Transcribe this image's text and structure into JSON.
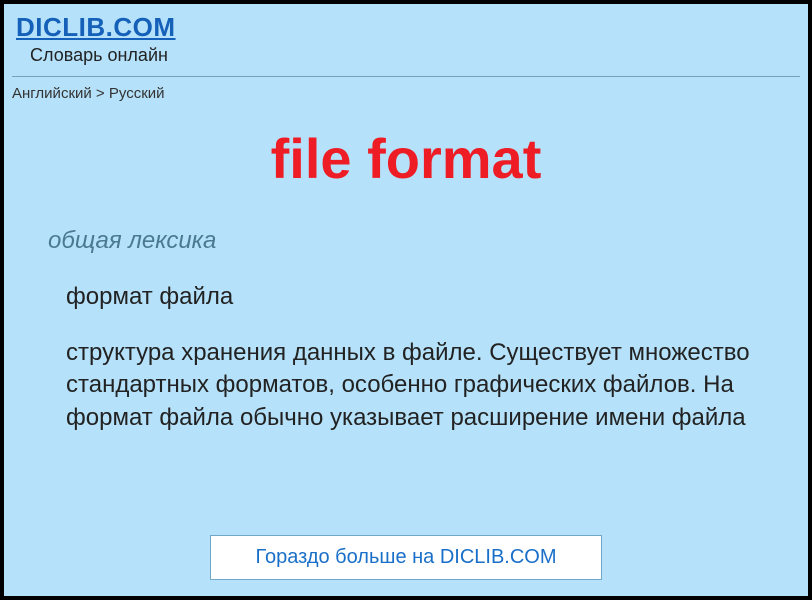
{
  "header": {
    "site_title": "DICLIB.COM",
    "site_subtitle": "Словарь онлайн"
  },
  "breadcrumb": {
    "text": "Английский > Русский"
  },
  "entry": {
    "title": "file format",
    "category": "общая лексика",
    "short_definition": "формат файла",
    "long_definition": "структура хранения данных в файле. Существует множество стандартных форматов, особенно графических файлов. На формат файла обычно указывает расширение имени файла"
  },
  "cta": {
    "more_label": "Гораздо больше на DICLIB.COM"
  }
}
